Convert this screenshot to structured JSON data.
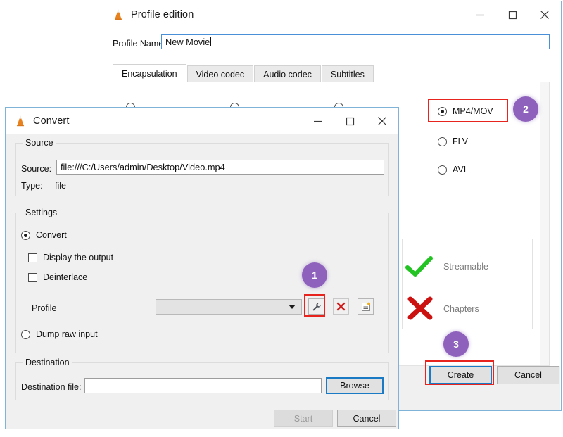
{
  "profile_window": {
    "title": "Profile edition",
    "icon": "vlc-cone-icon",
    "minimize": "minimize-icon",
    "maximize": "maximize-icon",
    "close": "close-icon",
    "profile_name_label": "Profile Name",
    "profile_name_value": "New Movie",
    "tabs": [
      {
        "label": "Encapsulation",
        "active": true
      },
      {
        "label": "Video codec",
        "active": false
      },
      {
        "label": "Audio codec",
        "active": false
      },
      {
        "label": "Subtitles",
        "active": false
      }
    ],
    "encapsulation_options": [
      {
        "label": "MP4/MOV",
        "selected": true
      },
      {
        "label": "FLV",
        "selected": false
      },
      {
        "label": "AVI",
        "selected": false
      }
    ],
    "features": [
      {
        "label": "Streamable",
        "state": "yes",
        "icon": "check-mark-icon"
      },
      {
        "label": "Chapters",
        "state": "no",
        "icon": "cross-mark-icon"
      }
    ],
    "create_button": "Create",
    "cancel_button": "Cancel"
  },
  "convert_window": {
    "title": "Convert",
    "icon": "vlc-cone-icon",
    "minimize": "minimize-icon",
    "maximize": "maximize-icon",
    "close": "close-icon",
    "source_group": "Source",
    "source_label": "Source:",
    "source_value": "file:///C:/Users/admin/Desktop/Video.mp4",
    "type_label": "Type:",
    "type_value": "file",
    "settings_group": "Settings",
    "convert_radio": "Convert",
    "display_output_check": "Display the output",
    "deinterlace_check": "Deinterlace",
    "profile_label": "Profile",
    "profile_value": "",
    "profile_edit_icon": "wrench-icon",
    "profile_delete_icon": "red-x-icon",
    "profile_new_icon": "new-profile-icon",
    "dump_raw_radio": "Dump raw input",
    "destination_group": "Destination",
    "destination_label": "Destination file:",
    "destination_value": "",
    "browse_button": "Browse",
    "start_button": "Start",
    "cancel_button": "Cancel"
  },
  "annotations": {
    "badges": [
      {
        "number": "1"
      },
      {
        "number": "2"
      },
      {
        "number": "3"
      }
    ],
    "highlight_color": "#e8241f",
    "badge_color": "#8e61bd"
  }
}
